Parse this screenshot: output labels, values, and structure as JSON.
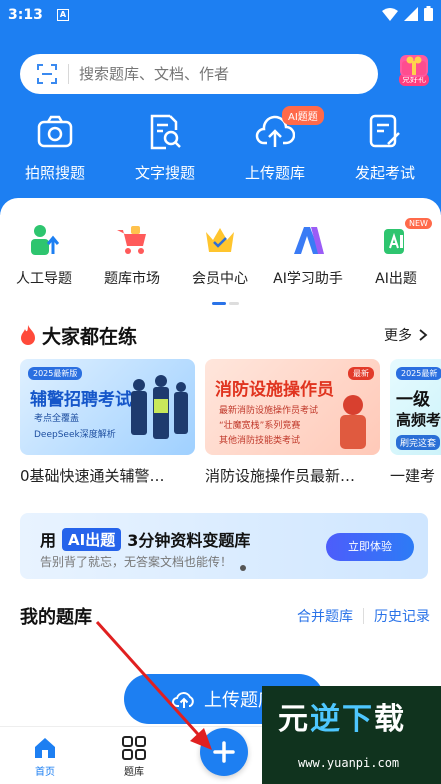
{
  "status_bar": {
    "time": "3:13",
    "notification_icon": "A"
  },
  "search": {
    "placeholder": "搜索题库、文档、作者",
    "scan_icon": "scan-icon"
  },
  "gift": {
    "label": "兑好礼"
  },
  "actions": [
    {
      "label": "拍照搜题",
      "icon": "camera-icon"
    },
    {
      "label": "文字搜题",
      "icon": "text-search-icon"
    },
    {
      "label": "上传题库",
      "icon": "cloud-upload-icon",
      "badge": "AI题题"
    },
    {
      "label": "发起考试",
      "icon": "edit-exam-icon"
    }
  ],
  "quick": [
    {
      "label": "人工导题",
      "icon": "person-upload-icon"
    },
    {
      "label": "题库市场",
      "icon": "cart-icon"
    },
    {
      "label": "会员中心",
      "icon": "crown-icon"
    },
    {
      "label": "AI学习助手",
      "icon": "ai-assistant-icon"
    },
    {
      "label": "AI出题",
      "icon": "ai-question-icon",
      "badge": "NEW"
    }
  ],
  "popular": {
    "title": "大家都在练",
    "more": "更多",
    "items": [
      {
        "caption": "0基础快速通关辅警…",
        "headline": "辅警招聘考试",
        "tag": "2025最新版",
        "lines": [
          "考点全覆盖",
          "DeepSeek深度解析"
        ]
      },
      {
        "caption": "消防设施操作员最新…",
        "headline": "消防设施操作员",
        "tag": "最新",
        "lines": [
          "最新消防设施操作员考试",
          "“壮魔宽栈”系列竞赛",
          "其他消防技能类考试"
        ]
      },
      {
        "caption": "一建考",
        "headline": "一级",
        "tag": "2025最新",
        "lines": [
          "高频考",
          "刷完这套"
        ]
      }
    ]
  },
  "promo": {
    "prefix": "用",
    "ai": "AI出题",
    "suffix": "3分钟资料变题库",
    "subtitle": "告别背了就忘，无答案文档也能传！",
    "button": "立即体验"
  },
  "my_bank": {
    "title": "我的题库",
    "link1": "合并题库",
    "link2": "历史记录"
  },
  "upload_button": "上传题库",
  "tabs": [
    {
      "label": "首页"
    },
    {
      "label": "题库"
    }
  ],
  "watermark": {
    "text_a": "元",
    "text_b": "逆下",
    "text_c": "载",
    "url": "www.yuanpi.com"
  },
  "colors": {
    "primary": "#1d7ff2",
    "accent": "#ff6a4a"
  }
}
